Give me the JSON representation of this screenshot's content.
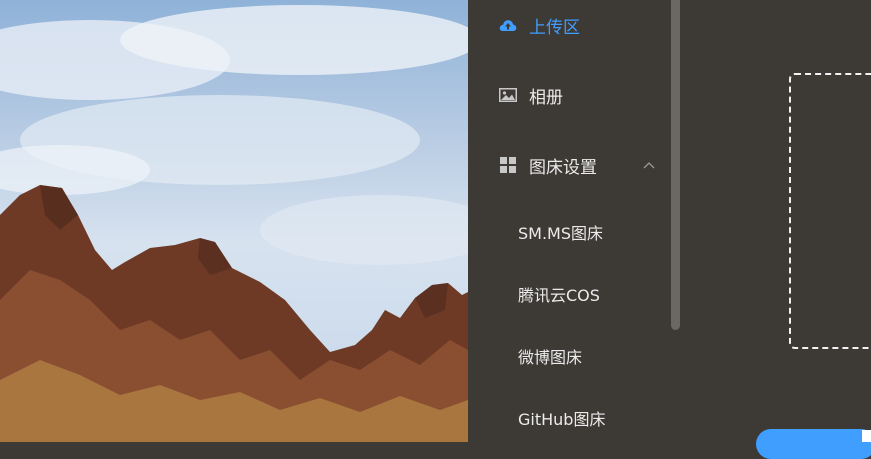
{
  "sidebar": {
    "upload": {
      "label": "上传区",
      "icon": "cloud-upload-icon"
    },
    "album": {
      "label": "相册",
      "icon": "picture-icon"
    },
    "settings": {
      "label": "图床设置",
      "icon": "grid-icon",
      "expanded": true
    },
    "submenu": [
      {
        "label": "SM.MS图床"
      },
      {
        "label": "腾讯云COS"
      },
      {
        "label": "微博图床"
      },
      {
        "label": "GitHub图床"
      }
    ]
  },
  "colors": {
    "accent": "#409eff",
    "panel": "#3d3935",
    "text": "#ebebeb"
  }
}
